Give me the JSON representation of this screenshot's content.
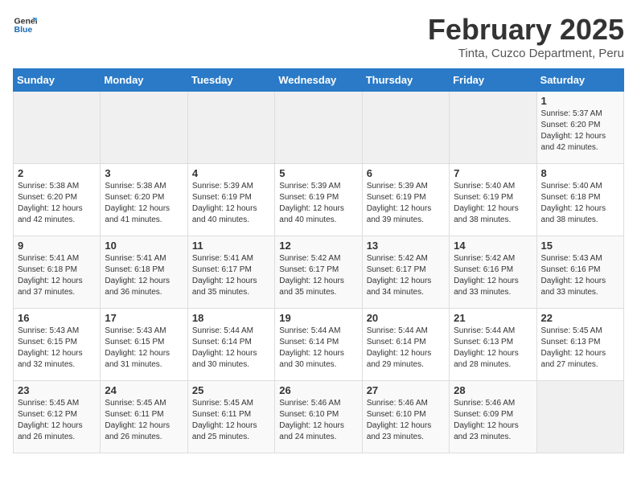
{
  "logo": {
    "general": "General",
    "blue": "Blue"
  },
  "title": "February 2025",
  "subtitle": "Tinta, Cuzco Department, Peru",
  "days_of_week": [
    "Sunday",
    "Monday",
    "Tuesday",
    "Wednesday",
    "Thursday",
    "Friday",
    "Saturday"
  ],
  "weeks": [
    [
      {
        "day": "",
        "info": ""
      },
      {
        "day": "",
        "info": ""
      },
      {
        "day": "",
        "info": ""
      },
      {
        "day": "",
        "info": ""
      },
      {
        "day": "",
        "info": ""
      },
      {
        "day": "",
        "info": ""
      },
      {
        "day": "1",
        "info": "Sunrise: 5:37 AM\nSunset: 6:20 PM\nDaylight: 12 hours\nand 42 minutes."
      }
    ],
    [
      {
        "day": "2",
        "info": "Sunrise: 5:38 AM\nSunset: 6:20 PM\nDaylight: 12 hours\nand 42 minutes."
      },
      {
        "day": "3",
        "info": "Sunrise: 5:38 AM\nSunset: 6:20 PM\nDaylight: 12 hours\nand 41 minutes."
      },
      {
        "day": "4",
        "info": "Sunrise: 5:39 AM\nSunset: 6:19 PM\nDaylight: 12 hours\nand 40 minutes."
      },
      {
        "day": "5",
        "info": "Sunrise: 5:39 AM\nSunset: 6:19 PM\nDaylight: 12 hours\nand 40 minutes."
      },
      {
        "day": "6",
        "info": "Sunrise: 5:39 AM\nSunset: 6:19 PM\nDaylight: 12 hours\nand 39 minutes."
      },
      {
        "day": "7",
        "info": "Sunrise: 5:40 AM\nSunset: 6:19 PM\nDaylight: 12 hours\nand 38 minutes."
      },
      {
        "day": "8",
        "info": "Sunrise: 5:40 AM\nSunset: 6:18 PM\nDaylight: 12 hours\nand 38 minutes."
      }
    ],
    [
      {
        "day": "9",
        "info": "Sunrise: 5:41 AM\nSunset: 6:18 PM\nDaylight: 12 hours\nand 37 minutes."
      },
      {
        "day": "10",
        "info": "Sunrise: 5:41 AM\nSunset: 6:18 PM\nDaylight: 12 hours\nand 36 minutes."
      },
      {
        "day": "11",
        "info": "Sunrise: 5:41 AM\nSunset: 6:17 PM\nDaylight: 12 hours\nand 35 minutes."
      },
      {
        "day": "12",
        "info": "Sunrise: 5:42 AM\nSunset: 6:17 PM\nDaylight: 12 hours\nand 35 minutes."
      },
      {
        "day": "13",
        "info": "Sunrise: 5:42 AM\nSunset: 6:17 PM\nDaylight: 12 hours\nand 34 minutes."
      },
      {
        "day": "14",
        "info": "Sunrise: 5:42 AM\nSunset: 6:16 PM\nDaylight: 12 hours\nand 33 minutes."
      },
      {
        "day": "15",
        "info": "Sunrise: 5:43 AM\nSunset: 6:16 PM\nDaylight: 12 hours\nand 33 minutes."
      }
    ],
    [
      {
        "day": "16",
        "info": "Sunrise: 5:43 AM\nSunset: 6:15 PM\nDaylight: 12 hours\nand 32 minutes."
      },
      {
        "day": "17",
        "info": "Sunrise: 5:43 AM\nSunset: 6:15 PM\nDaylight: 12 hours\nand 31 minutes."
      },
      {
        "day": "18",
        "info": "Sunrise: 5:44 AM\nSunset: 6:14 PM\nDaylight: 12 hours\nand 30 minutes."
      },
      {
        "day": "19",
        "info": "Sunrise: 5:44 AM\nSunset: 6:14 PM\nDaylight: 12 hours\nand 30 minutes."
      },
      {
        "day": "20",
        "info": "Sunrise: 5:44 AM\nSunset: 6:14 PM\nDaylight: 12 hours\nand 29 minutes."
      },
      {
        "day": "21",
        "info": "Sunrise: 5:44 AM\nSunset: 6:13 PM\nDaylight: 12 hours\nand 28 minutes."
      },
      {
        "day": "22",
        "info": "Sunrise: 5:45 AM\nSunset: 6:13 PM\nDaylight: 12 hours\nand 27 minutes."
      }
    ],
    [
      {
        "day": "23",
        "info": "Sunrise: 5:45 AM\nSunset: 6:12 PM\nDaylight: 12 hours\nand 26 minutes."
      },
      {
        "day": "24",
        "info": "Sunrise: 5:45 AM\nSunset: 6:11 PM\nDaylight: 12 hours\nand 26 minutes."
      },
      {
        "day": "25",
        "info": "Sunrise: 5:45 AM\nSunset: 6:11 PM\nDaylight: 12 hours\nand 25 minutes."
      },
      {
        "day": "26",
        "info": "Sunrise: 5:46 AM\nSunset: 6:10 PM\nDaylight: 12 hours\nand 24 minutes."
      },
      {
        "day": "27",
        "info": "Sunrise: 5:46 AM\nSunset: 6:10 PM\nDaylight: 12 hours\nand 23 minutes."
      },
      {
        "day": "28",
        "info": "Sunrise: 5:46 AM\nSunset: 6:09 PM\nDaylight: 12 hours\nand 23 minutes."
      },
      {
        "day": "",
        "info": ""
      }
    ]
  ]
}
